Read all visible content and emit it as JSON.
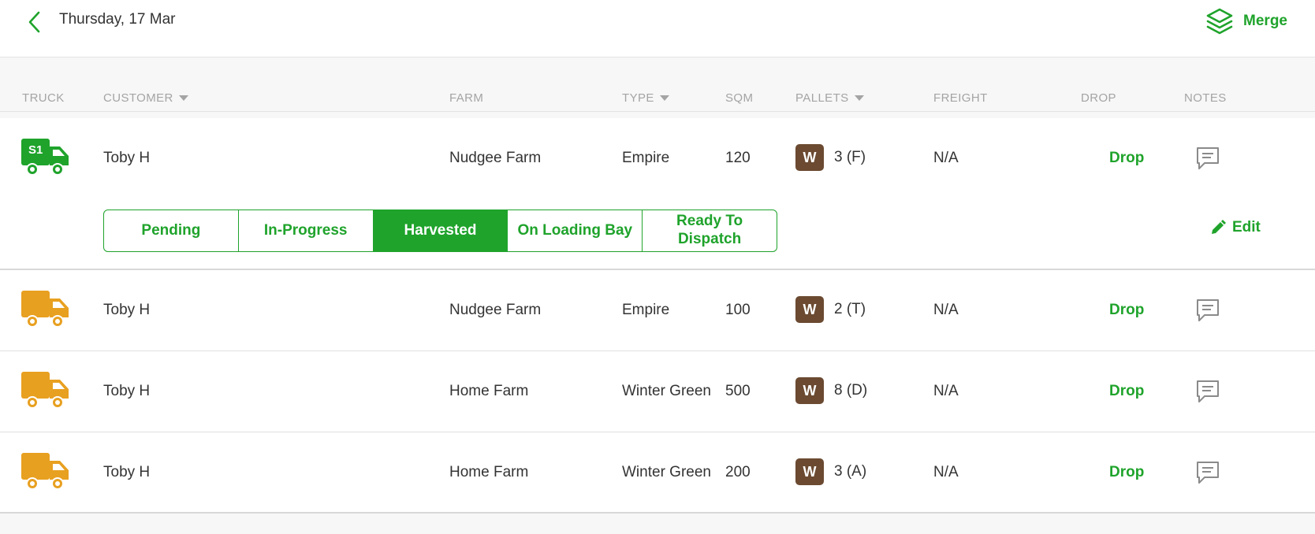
{
  "header": {
    "date": "Thursday, 17 Mar",
    "merge_label": "Merge"
  },
  "columns": {
    "truck": "TRUCK",
    "customer": "CUSTOMER",
    "farm": "FARM",
    "type": "TYPE",
    "sqm": "SQM",
    "pallets": "PALLETS",
    "freight": "FREIGHT",
    "drop": "DROP",
    "notes": "NOTES"
  },
  "rows": [
    {
      "truck_badge": "S1",
      "truck_color": "#1fa32b",
      "customer": "Toby H",
      "farm": "Nudgee Farm",
      "type": "Empire",
      "sqm": "120",
      "pallet_badge": "W",
      "pallets": "3 (F)",
      "freight": "N/A",
      "drop": "Drop"
    },
    {
      "truck_badge": "",
      "truck_color": "#e8a020",
      "customer": "Toby H",
      "farm": "Nudgee Farm",
      "type": "Empire",
      "sqm": "100",
      "pallet_badge": "W",
      "pallets": "2 (T)",
      "freight": "N/A",
      "drop": "Drop"
    },
    {
      "truck_badge": "",
      "truck_color": "#e8a020",
      "customer": "Toby H",
      "farm": "Home Farm",
      "type": "Winter Green",
      "sqm": "500",
      "pallet_badge": "W",
      "pallets": "8 (D)",
      "freight": "N/A",
      "drop": "Drop"
    },
    {
      "truck_badge": "",
      "truck_color": "#e8a020",
      "customer": "Toby H",
      "farm": "Home Farm",
      "type": "Winter Green",
      "sqm": "200",
      "pallet_badge": "W",
      "pallets": "3 (A)",
      "freight": "N/A",
      "drop": "Drop"
    }
  ],
  "status_steps": [
    "Pending",
    "In-Progress",
    "Harvested",
    "On Loading Bay",
    "Ready To Dispatch"
  ],
  "active_status": "Harvested",
  "edit_label": "Edit",
  "colors": {
    "accent": "#1fa32b",
    "truck_pending": "#e8a020",
    "pallet_badge": "#6b4a31"
  },
  "icons": {
    "back": "chevron-left-icon",
    "merge": "layers-icon",
    "truck": "truck-icon",
    "notes": "comment-icon",
    "edit": "pencil-icon",
    "sort": "caret-down-icon"
  }
}
